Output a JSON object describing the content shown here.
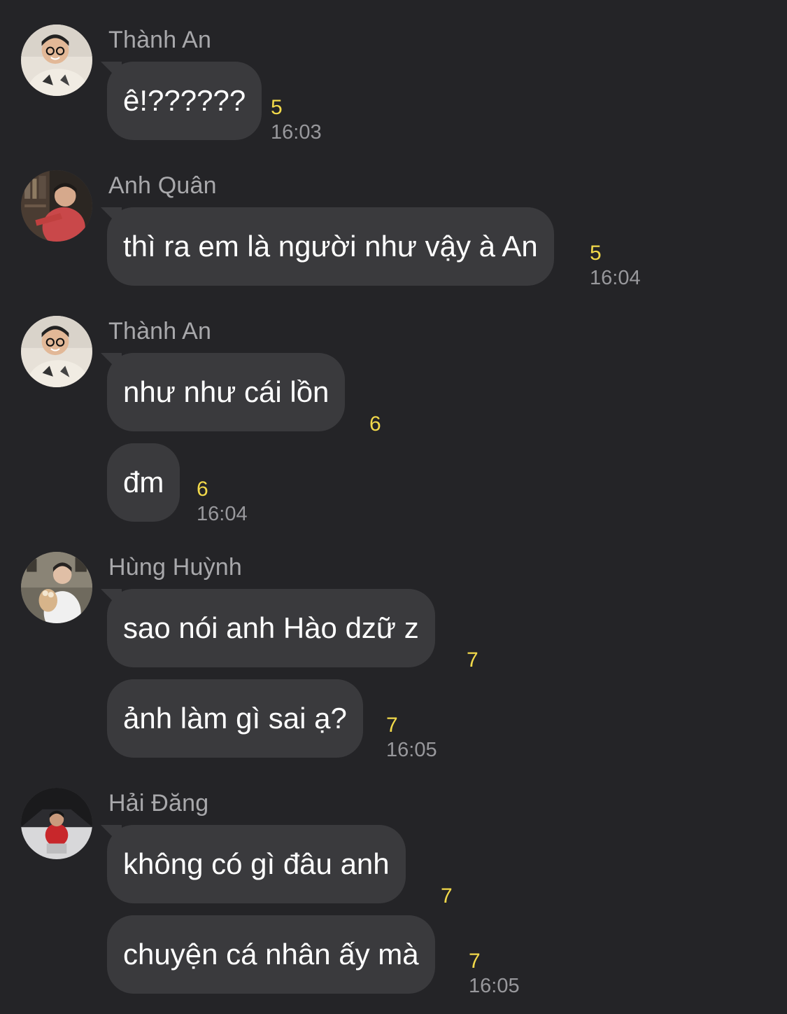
{
  "colors": {
    "background": "#242427",
    "bubble": "#3a3a3d",
    "sender_name": "#a8a8ab",
    "unread_count": "#f2d94a",
    "timestamp": "#98989c"
  },
  "messages": [
    {
      "sender": "Thành An",
      "avatar": "avatar-thanh-an",
      "bubbles": [
        {
          "text": "ê!??????",
          "count": "5",
          "time": "16:03"
        }
      ]
    },
    {
      "sender": "Anh Quân",
      "avatar": "avatar-anh-quan",
      "bubbles": [
        {
          "text": "thì ra em là người như vậy à An",
          "count": "5",
          "time": "16:04"
        }
      ]
    },
    {
      "sender": "Thành An",
      "avatar": "avatar-thanh-an",
      "bubbles": [
        {
          "text": "như như cái lồn",
          "count": "6"
        },
        {
          "text": "đm",
          "count": "6",
          "time": "16:04"
        }
      ]
    },
    {
      "sender": "Hùng Huỳnh",
      "avatar": "avatar-hung-huynh",
      "bubbles": [
        {
          "text": "sao nói anh Hào dzữ z",
          "count": "7"
        },
        {
          "text": "ảnh làm gì sai ạ?",
          "count": "7",
          "time": "16:05"
        }
      ]
    },
    {
      "sender": "Hải Đăng",
      "avatar": "avatar-hai-dang",
      "bubbles": [
        {
          "text": "không có gì đâu anh",
          "count": "7"
        },
        {
          "text": "chuyện cá nhân ấy mà",
          "count": "7",
          "time": "16:05"
        }
      ]
    }
  ]
}
